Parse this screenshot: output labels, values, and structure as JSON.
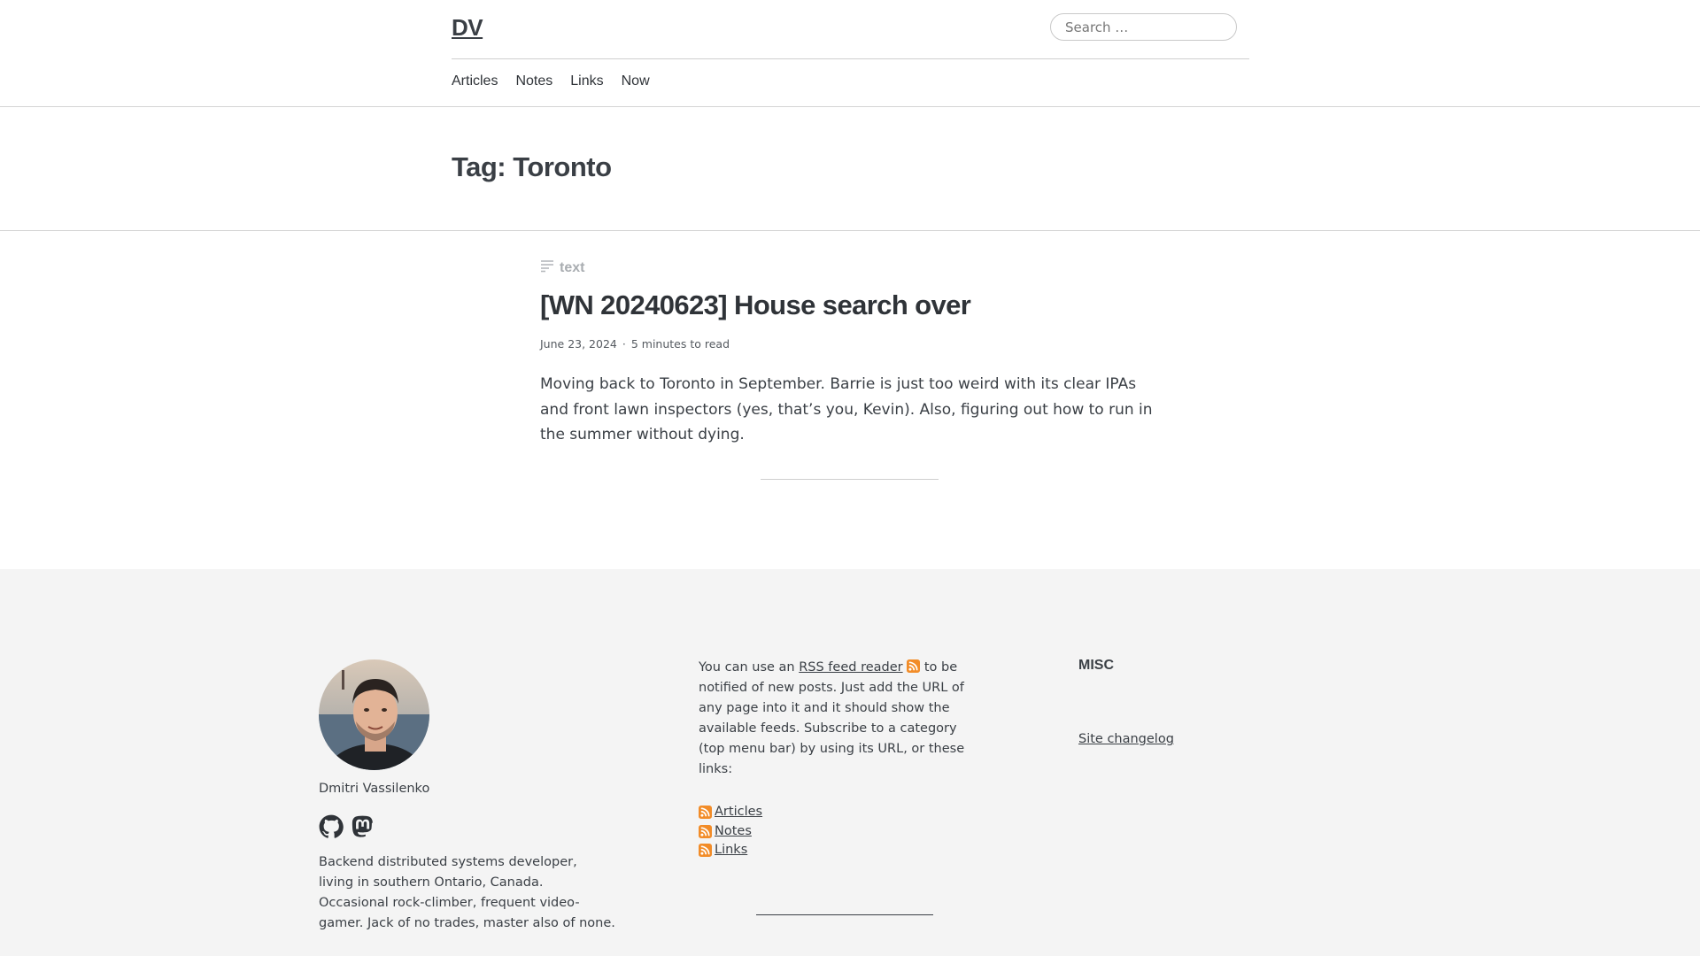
{
  "header": {
    "site_title": "DV",
    "search_placeholder": "Search …",
    "nav": [
      {
        "label": "Articles"
      },
      {
        "label": "Notes"
      },
      {
        "label": "Links"
      },
      {
        "label": "Now"
      }
    ]
  },
  "tag": {
    "title": "Tag: Toronto"
  },
  "post": {
    "type_label": "text",
    "type_icon": "text-lines-icon",
    "title": "[WN 20240623] House search over",
    "date": "June 23, 2024",
    "separator": "·",
    "read_time": "5 minutes to read",
    "excerpt": "Moving back to Toronto in September. Barrie is just too weird with its clear IPAs and front lawn inspectors (yes, that’s you, Kevin). Also, figuring out how to run in the summer without dying."
  },
  "footer": {
    "author": {
      "name": "Dmitri Vassilenko",
      "social": [
        "github-icon",
        "mastodon-icon"
      ],
      "bio": "Backend distributed systems developer, living in southern Ontario, Canada. Occasional rock-climber, frequent video-gamer. Jack of no trades, master also of none."
    },
    "rss": {
      "text_before": "You can use an ",
      "link_label": "RSS feed reader",
      "text_after": " to be notified of new posts. Just add the URL of any page into it and it should show the available feeds. Subscribe to a category (top menu bar) by using its URL, or these links:",
      "feeds": [
        {
          "label": " Articles"
        },
        {
          "label": " Notes"
        },
        {
          "label": " Links"
        }
      ]
    },
    "misc": {
      "title": "MISC",
      "link_label": "Site changelog"
    }
  },
  "colors": {
    "text": "#2f3338",
    "muted": "#a9adb1",
    "footer_bg": "#f4f4f4",
    "rss_orange": "#f28c28"
  }
}
